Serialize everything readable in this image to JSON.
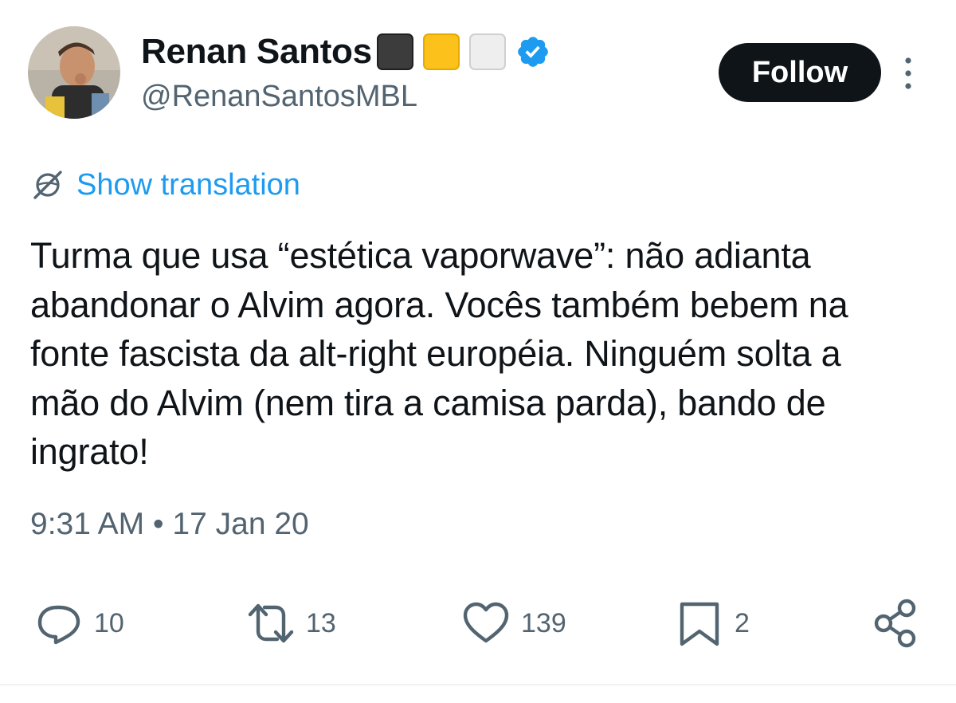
{
  "author": {
    "display_name": "Renan Santos",
    "handle": "@RenanSantosMBL",
    "name_emojis": [
      "black-square-emoji",
      "yellow-square-emoji",
      "white-square-emoji"
    ],
    "verified": true
  },
  "header": {
    "follow_label": "Follow"
  },
  "translation": {
    "label": "Show translation"
  },
  "tweet": {
    "text": "Turma que usa “estética vaporwave”: não adianta abandonar o Alvim agora. Vocês também bebem na fonte fascista da alt-right européia. Ninguém solta a mão do Alvim (nem tira a camisa parda), bando de ingrato!",
    "timestamp": "9:31 AM • 17 Jan 20"
  },
  "actions": {
    "replies": "10",
    "reposts": "13",
    "likes": "139",
    "bookmarks": "2"
  },
  "colors": {
    "accent": "#1d9bf0",
    "text": "#0f1419",
    "secondary": "#536471",
    "verified": "#1d9bf0",
    "follow_bg": "#0f1419"
  },
  "icons": {
    "translate": "translate-globe-icon",
    "more": "more-vertical-icon",
    "reply": "reply-icon",
    "repost": "repost-icon",
    "like": "heart-icon",
    "bookmark": "bookmark-icon",
    "share": "share-icon"
  }
}
